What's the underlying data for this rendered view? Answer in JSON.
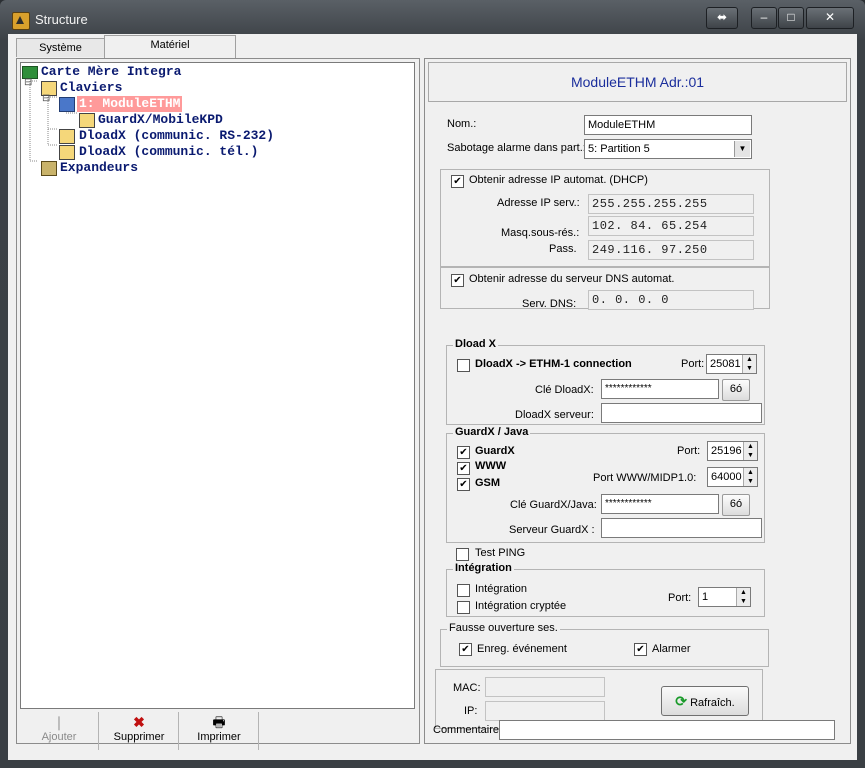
{
  "window": {
    "title": "Structure",
    "title_color": "#f2f2f2"
  },
  "titlebar_buttons": {
    "resize": "⬌",
    "minimize": "–",
    "maximize": "□",
    "close": "✕"
  },
  "tabs": [
    {
      "label": "Système"
    },
    {
      "label": "Matériel"
    }
  ],
  "tree": {
    "root": "Carte Mère Integra",
    "claviers": "Claviers",
    "selected": " 1: ModuleETHM",
    "guardx": "GuardX/MobileKPD",
    "dload1": "DloadX (communic. RS-232)",
    "dload2": "DloadX (communic. tél.)",
    "expandeurs": "Expandeurs",
    "expander_plus": "⊟"
  },
  "toolbar": {
    "add": "Ajouter",
    "delete": "Supprimer",
    "print": "Imprimer"
  },
  "panel": {
    "header": "ModuleETHM Adr.:01",
    "name_label": "Nom.:",
    "name_value": "ModuleETHM",
    "sabotage_label": "Sabotage alarme dans part.:",
    "sabotage_value": "5: Partition  5",
    "dhcp_label": "Obtenir adresse IP automat. (DHCP)",
    "ip_serv_label": "Adresse IP serv.:",
    "ip_serv_value": "255.255.255.255",
    "mask_label": "Masq.sous-rés.:",
    "mask_value": "102. 84. 65.254",
    "pass_label": "Pass.",
    "pass_value": "249.116. 97.250",
    "dns_auto_label": "Obtenir adresse du serveur DNS automat.",
    "dns_label": "Serv. DNS:",
    "dns_value": "  0.  0.  0.  0",
    "dloadx": {
      "title": "Dload X",
      "connection_label": "DloadX -> ETHM-1 connection",
      "port_label": "Port:",
      "port_value": "25081",
      "key_label": "Clé DloadX:",
      "key_value": "************",
      "eye": "6ó",
      "server_label": "DloadX serveur:",
      "server_value": ""
    },
    "guardx": {
      "title": "GuardX / Java",
      "guardx_label": "GuardX",
      "www_label": "WWW",
      "gsm_label": "GSM",
      "port_label": "Port:",
      "port_value": "25196",
      "port_www_label": "Port WWW/MIDP1.0:",
      "port_www_value": "64000",
      "key_label": "Clé GuardX/Java:",
      "key_value": "************",
      "eye": "6ó",
      "server_label": "Serveur GuardX :",
      "server_value": ""
    },
    "test_ping_label": "Test PING",
    "integration": {
      "title": "Intégration",
      "integration_label": "Intégration",
      "crypted_label": "Intégration cryptée",
      "port_label": "Port:",
      "port_value": "1"
    },
    "fausse": {
      "title": "Fausse ouverture ses.",
      "enreg_label": "Enreg. événement",
      "alarmer_label": "Alarmer"
    },
    "mac_label": "MAC:",
    "mac_value": "",
    "ip_label": "IP:",
    "ip_value": "",
    "refresh_label": "Rafraîch.",
    "comment_label": "Commentaire:",
    "comment_value": ""
  },
  "colors": {
    "accent": "#1b2e9c",
    "tree_text": "#0a1a70",
    "selected_bg": "#ff9a9a"
  }
}
